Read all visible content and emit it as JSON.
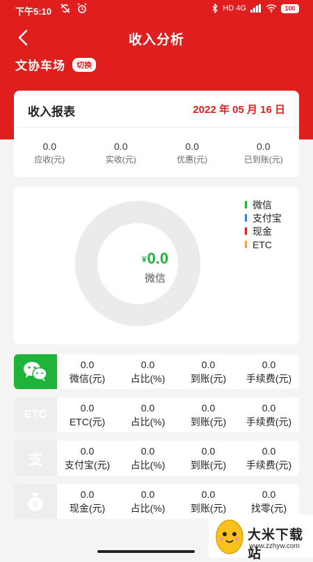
{
  "status_bar": {
    "time": "下午5:10",
    "network": "HD 4G",
    "battery": "100"
  },
  "header": {
    "title": "收入分析",
    "parking_lot": "文协车场",
    "switch_label": "切换"
  },
  "report": {
    "title": "收入报表",
    "date": "2022 年 05 月 16 日",
    "stats": [
      {
        "value": "0.0",
        "label": "应收(元)"
      },
      {
        "value": "0.0",
        "label": "实收(元)"
      },
      {
        "value": "0.0",
        "label": "优惠(元)"
      },
      {
        "value": "0.0",
        "label": "已到账(元)"
      }
    ]
  },
  "chart": {
    "center_currency": "¥",
    "center_value": "0.0",
    "center_label": "微信",
    "legend": [
      {
        "name": "微信",
        "color": "#1fb33a"
      },
      {
        "name": "支付宝",
        "color": "#3a7be0"
      },
      {
        "name": "现金",
        "color": "#e01e1e"
      },
      {
        "name": "ETC",
        "color": "#f0a04b"
      }
    ]
  },
  "chart_data": {
    "type": "pie",
    "categories": [
      "微信",
      "支付宝",
      "现金",
      "ETC"
    ],
    "values": [
      0,
      0,
      0,
      0
    ]
  },
  "payments": [
    {
      "icon": "wechat-icon",
      "active": true,
      "cells": [
        {
          "value": "0.0",
          "label": "微信(元)"
        },
        {
          "value": "0.0",
          "label": "占比(%)"
        },
        {
          "value": "0.0",
          "label": "到账(元)"
        },
        {
          "value": "0.0",
          "label": "手续费(元)"
        }
      ]
    },
    {
      "icon": "etc-icon",
      "icon_text": "ETC",
      "active": false,
      "cells": [
        {
          "value": "0.0",
          "label": "ETC(元)"
        },
        {
          "value": "0.0",
          "label": "占比(%)"
        },
        {
          "value": "0.0",
          "label": "到账(元)"
        },
        {
          "value": "0.0",
          "label": "手续费(元)"
        }
      ]
    },
    {
      "icon": "alipay-icon",
      "icon_text": "支",
      "active": false,
      "cells": [
        {
          "value": "0.0",
          "label": "支付宝(元)"
        },
        {
          "value": "0.0",
          "label": "占比(%)"
        },
        {
          "value": "0.0",
          "label": "到账(元)"
        },
        {
          "value": "0.0",
          "label": "手续费(元)"
        }
      ]
    },
    {
      "icon": "cash-icon",
      "icon_text": "¥",
      "active": false,
      "cells": [
        {
          "value": "0.0",
          "label": "现金(元)"
        },
        {
          "value": "0.0",
          "label": "占比(%)"
        },
        {
          "value": "0.0",
          "label": "到账(元)"
        },
        {
          "value": "0.0",
          "label": "找零(元)"
        }
      ]
    }
  ],
  "watermark": {
    "text": "大米下载站",
    "url": "www.zzhyw.com"
  }
}
